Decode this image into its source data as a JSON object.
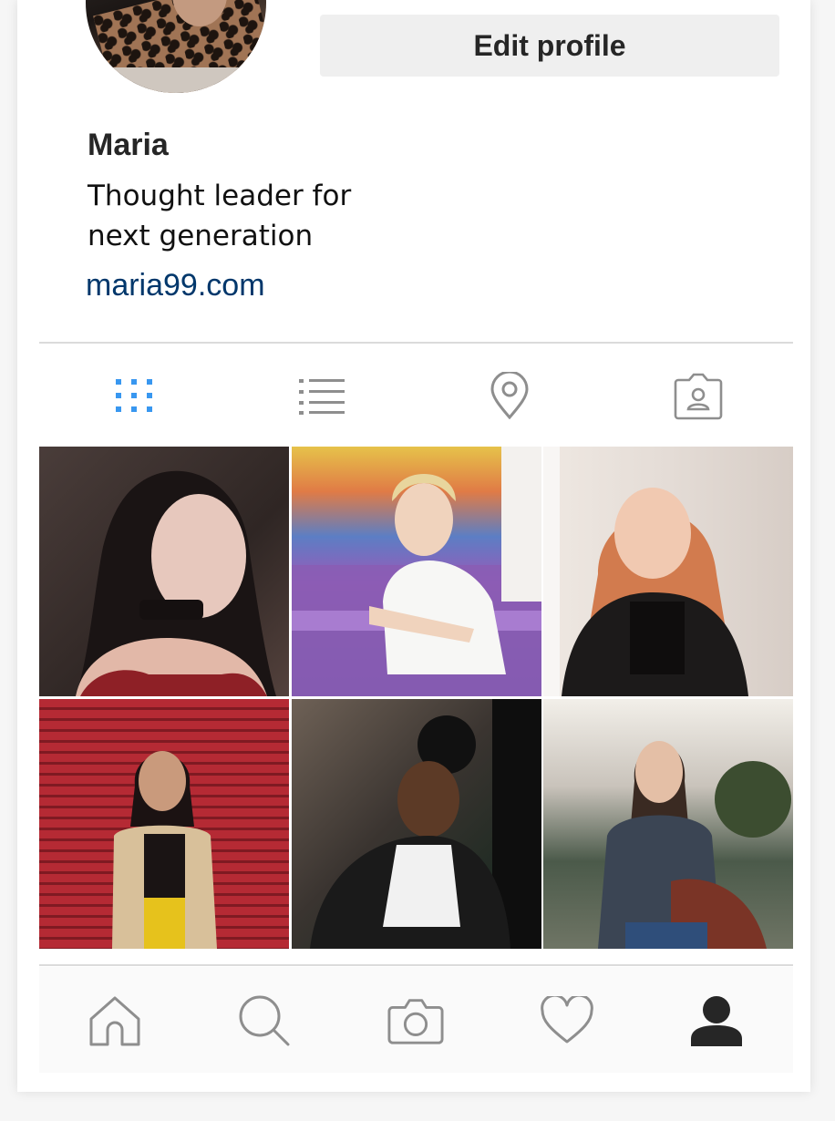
{
  "profile": {
    "name": "Maria",
    "bio_line1": "Thought leader for",
    "bio_line2": "next generation",
    "website": "maria99.com",
    "edit_button": "Edit profile"
  },
  "tabs": [
    {
      "name": "grid-icon",
      "active": true
    },
    {
      "name": "list-icon",
      "active": false
    },
    {
      "name": "location-pin-icon",
      "active": false
    },
    {
      "name": "tagged-person-icon",
      "active": false
    }
  ],
  "photos": [
    {
      "name": "photo-1"
    },
    {
      "name": "photo-2"
    },
    {
      "name": "photo-3"
    },
    {
      "name": "photo-4"
    },
    {
      "name": "photo-5"
    },
    {
      "name": "photo-6"
    }
  ],
  "bottom_nav": [
    {
      "name": "home-icon"
    },
    {
      "name": "search-icon"
    },
    {
      "name": "camera-icon"
    },
    {
      "name": "heart-icon"
    },
    {
      "name": "profile-icon",
      "active": true
    }
  ],
  "colors": {
    "active_tab": "#3897f0",
    "inactive_icon": "#8e8e8e",
    "link": "#00376b"
  }
}
